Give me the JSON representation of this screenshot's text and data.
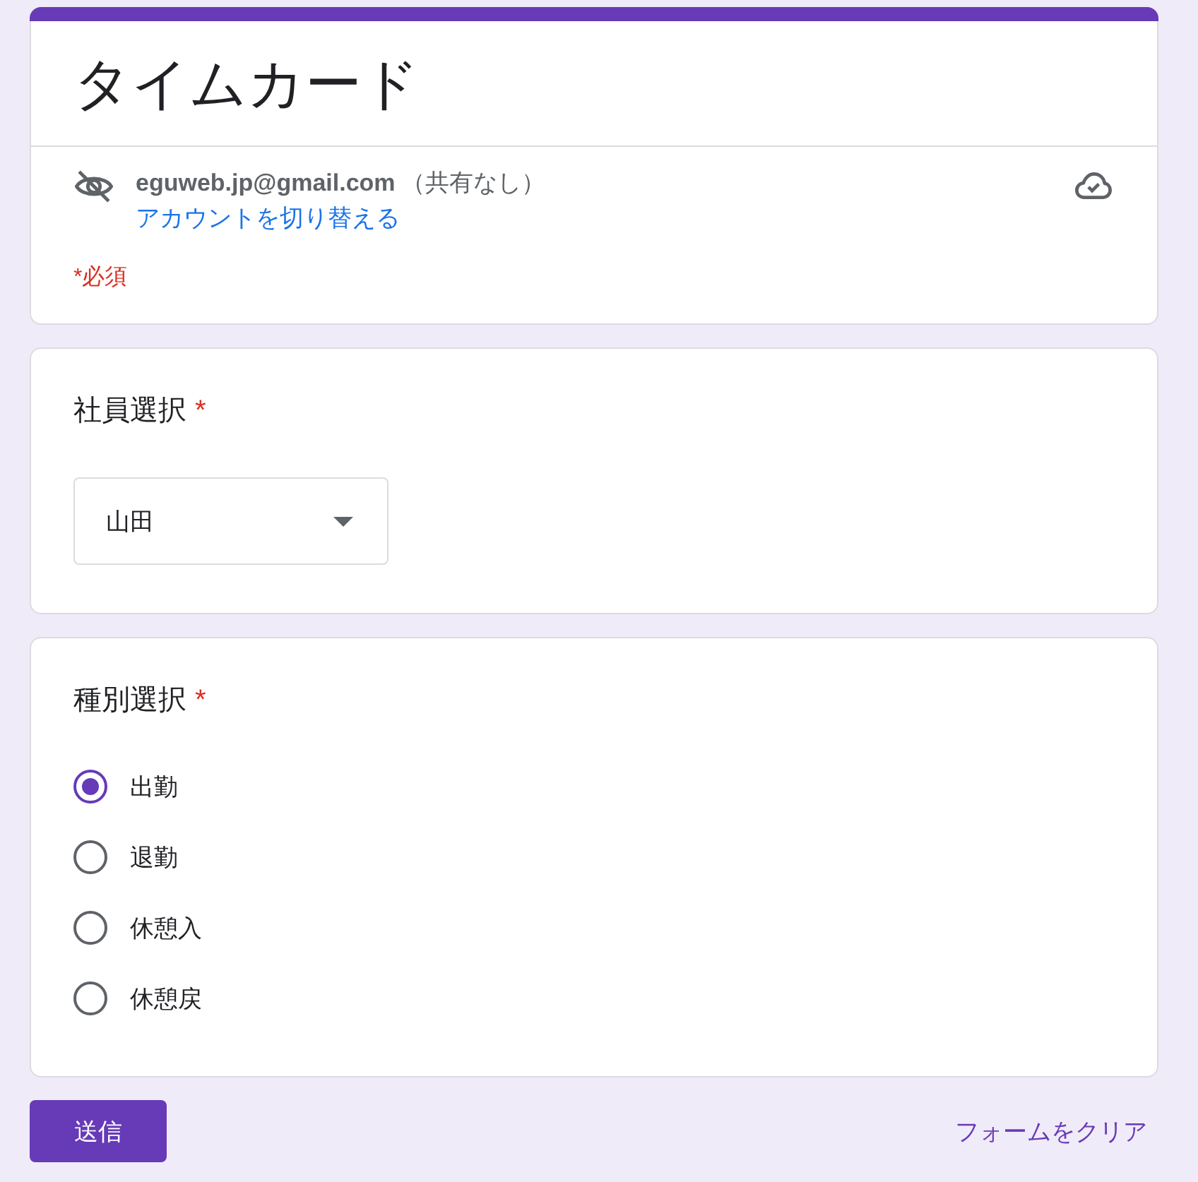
{
  "form": {
    "title": "タイムカード",
    "account": {
      "email": "eguweb.jp@gmail.com",
      "sharing": "（共有なし）",
      "switch_link": "アカウントを切り替える"
    },
    "required_note": "*必須"
  },
  "questions": [
    {
      "kind": "dropdown",
      "title": "社員選択",
      "required_mark": "*",
      "value": "山田"
    },
    {
      "kind": "radio",
      "title": "種別選択",
      "required_mark": "*",
      "options": [
        {
          "label": "出勤",
          "selected": true
        },
        {
          "label": "退勤",
          "selected": false
        },
        {
          "label": "休憩入",
          "selected": false
        },
        {
          "label": "休憩戻",
          "selected": false
        }
      ]
    }
  ],
  "footer": {
    "submit": "送信",
    "clear": "フォームをクリア"
  }
}
